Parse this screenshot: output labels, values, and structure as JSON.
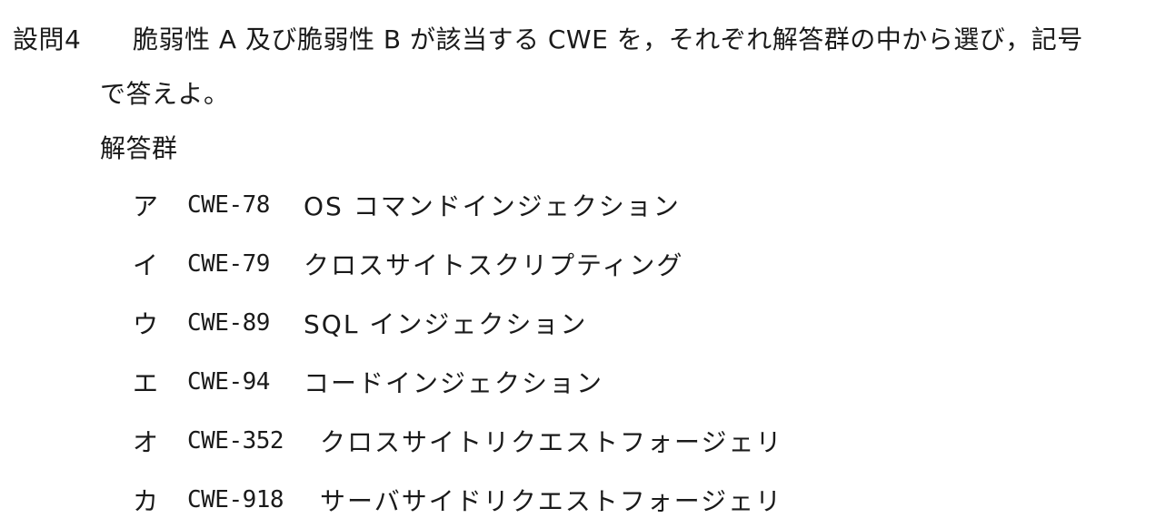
{
  "question": {
    "number": "設問4",
    "text_line1": "脆弱性 A 及び脆弱性 B が該当する CWE を，それぞれ解答群の中から選び，記号",
    "text_line2": "で答えよ。"
  },
  "answer_group": {
    "title": "解答群",
    "choices": [
      {
        "symbol": "ア",
        "code": "CWE-78",
        "name": "OS コマンドインジェクション"
      },
      {
        "symbol": "イ",
        "code": "CWE-79",
        "name": "クロスサイトスクリプティング"
      },
      {
        "symbol": "ウ",
        "code": "CWE-89",
        "name": "SQL インジェクション"
      },
      {
        "symbol": "エ",
        "code": "CWE-94",
        "name": "コードインジェクション"
      },
      {
        "symbol": "オ",
        "code": "CWE-352",
        "name": "クロスサイトリクエストフォージェリ"
      },
      {
        "symbol": "カ",
        "code": "CWE-918",
        "name": "サーバサイドリクエストフォージェリ"
      }
    ]
  }
}
